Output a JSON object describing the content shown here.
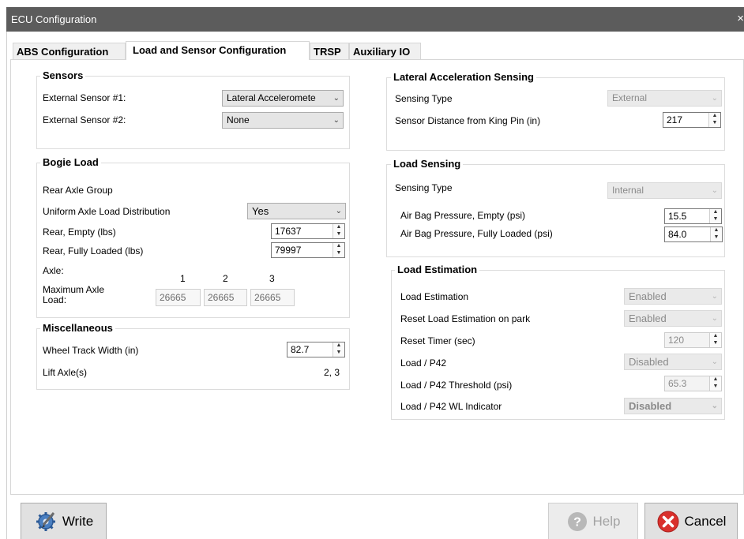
{
  "window": {
    "title": "ECU Configuration",
    "close_glyph": "×"
  },
  "tabs": [
    {
      "label": "ABS Configuration",
      "active": false
    },
    {
      "label": "Load and Sensor Configuration",
      "active": true
    },
    {
      "label": "TRSP",
      "active": false
    },
    {
      "label": "Auxiliary IO",
      "active": false
    }
  ],
  "sensors": {
    "title": "Sensors",
    "ext1_label": "External Sensor #1:",
    "ext1_value": "Lateral Acceleromete",
    "ext2_label": "External Sensor #2:",
    "ext2_value": "None"
  },
  "bogie": {
    "title": "Bogie Load",
    "rear_axle_group": "Rear Axle Group",
    "uniform_label": "Uniform Axle Load Distribution",
    "uniform_value": "Yes",
    "rear_empty_label": "Rear, Empty (lbs)",
    "rear_empty_value": "17637",
    "rear_full_label": "Rear, Fully Loaded (lbs)",
    "rear_full_value": "79997",
    "axle_label": "Axle:",
    "axle_numbers": [
      "1",
      "2",
      "3"
    ],
    "max_load_label_1": "Maximum Axle",
    "max_load_label_2": "Load:",
    "max_loads": [
      "26665",
      "26665",
      "26665"
    ]
  },
  "misc": {
    "title": "Miscellaneous",
    "track_label": "Wheel Track Width (in)",
    "track_value": "82.7",
    "lift_label": "Lift Axle(s)",
    "lift_value": "2, 3"
  },
  "lateral": {
    "title": "Lateral Acceleration Sensing",
    "type_label": "Sensing Type",
    "type_value": "External",
    "distance_label": "Sensor Distance from King Pin (in)",
    "distance_value": "217"
  },
  "load_sensing": {
    "title": "Load Sensing",
    "type_label": "Sensing Type",
    "type_value": "Internal",
    "empty_label": "Air Bag Pressure, Empty (psi)",
    "empty_value": "15.5",
    "full_label": "Air Bag Pressure, Fully Loaded (psi)",
    "full_value": "84.0"
  },
  "estimation": {
    "title": "Load Estimation",
    "est_label": "Load Estimation",
    "est_value": "Enabled",
    "reset_label": "Reset Load Estimation on park",
    "reset_value": "Enabled",
    "timer_label": "Reset Timer (sec)",
    "timer_value": "120",
    "p42_label": "Load / P42",
    "p42_value": "Disabled",
    "threshold_label": "Load / P42 Threshold (psi)",
    "threshold_value": "65.3",
    "wl_label": "Load / P42 WL Indicator",
    "wl_value": "Disabled"
  },
  "buttons": {
    "write": "Write",
    "help": "Help",
    "cancel": "Cancel"
  },
  "icons": {
    "write": "gear-pencil-icon",
    "help": "help-icon",
    "cancel": "cancel-icon"
  },
  "colors": {
    "titlebar": "#5c5c5c",
    "cancel_red": "#d9302c"
  }
}
